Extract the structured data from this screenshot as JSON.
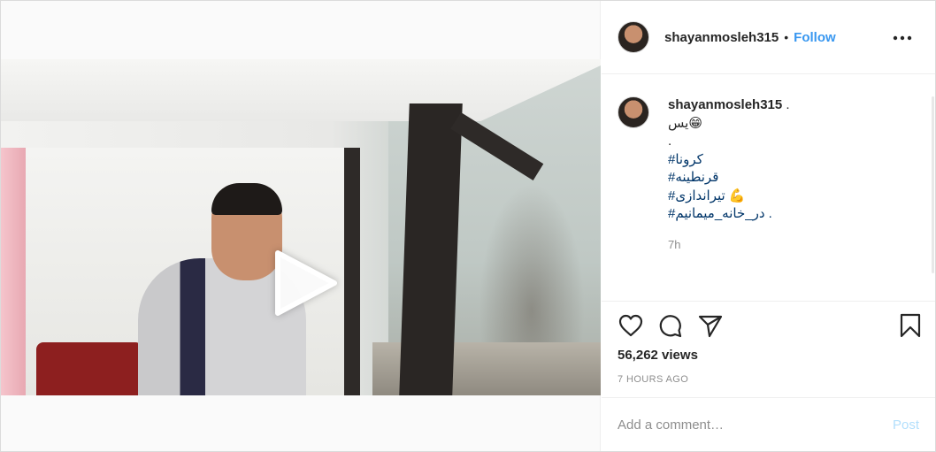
{
  "post": {
    "username": "shayanmosleh315",
    "separator": "•",
    "follow_label": "Follow",
    "more_icon": "more-options-icon"
  },
  "caption": {
    "username": "shayanmosleh315",
    "trailing": " .",
    "lines": [
      "یس😁",
      ".",
      "#کرونا",
      "#قرنطینه",
      "#تیراندازی 💪",
      "#در_خانه_میمانیم ."
    ],
    "time": "7h"
  },
  "actions": {
    "like_icon": "heart-icon",
    "comment_icon": "comment-icon",
    "share_icon": "share-icon",
    "save_icon": "bookmark-icon"
  },
  "stats": {
    "views": "56,262 views",
    "timestamp": "7 HOURS AGO"
  },
  "comment": {
    "placeholder": "Add a comment…",
    "post_label": "Post"
  },
  "colors": {
    "accent": "#3897f0",
    "post_disabled": "#b2dffc",
    "hashtag": "#003569",
    "muted": "#8e8e8e"
  }
}
